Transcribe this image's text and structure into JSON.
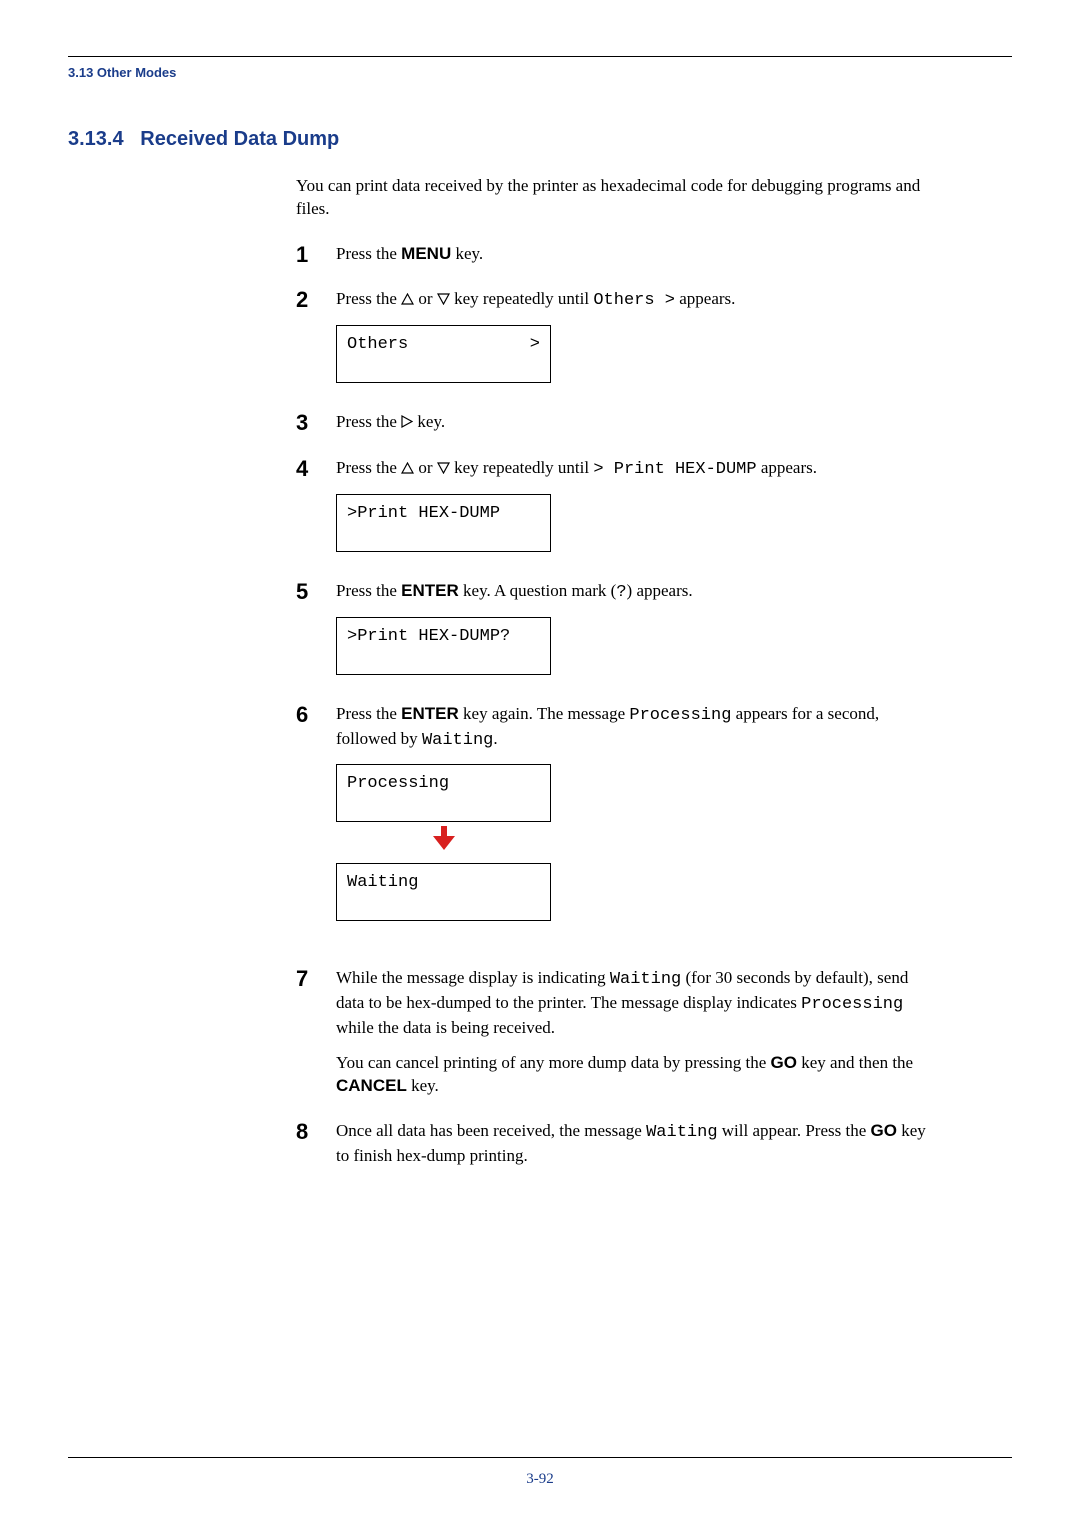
{
  "header": {
    "running": "3.13 Other Modes"
  },
  "section": {
    "number": "3.13.4",
    "title": "Received Data Dump",
    "intro": "You can print data received by the printer as hexadecimal code for debugging programs and files."
  },
  "keys": {
    "menu": "MENU",
    "enter": "ENTER",
    "go": "GO",
    "cancel": "CANCEL"
  },
  "steps": {
    "s1": {
      "num": "1",
      "text_a": "Press the ",
      "text_b": " key."
    },
    "s2": {
      "num": "2",
      "text_a": "Press the ",
      "text_b": " or ",
      "text_c": " key repeatedly until ",
      "mono": "Others >",
      "text_d": " appears.",
      "lcd_left": "Others",
      "lcd_right": ">"
    },
    "s3": {
      "num": "3",
      "text_a": "Press the ",
      "text_b": " key."
    },
    "s4": {
      "num": "4",
      "text_a": "Press the ",
      "text_b": " or ",
      "text_c": " key repeatedly until ",
      "mono1": "> Print HEX-DUMP",
      "text_d": " appears.",
      "lcd": ">Print HEX-DUMP"
    },
    "s5": {
      "num": "5",
      "text_a": "Press the ",
      "text_b": " key. A question mark (",
      "mono_q": "?",
      "text_c": ") appears.",
      "lcd": ">Print HEX-DUMP?"
    },
    "s6": {
      "num": "6",
      "text_a": "Press the ",
      "text_b": " key again. The message ",
      "mono1": "Processing",
      "text_c": " appears for a second, followed by ",
      "mono2": "Waiting",
      "text_d": ".",
      "lcd1": "Processing",
      "lcd2": "Waiting"
    },
    "s7": {
      "num": "7",
      "p1_a": "While the message display is indicating ",
      "p1_m1": "Waiting",
      "p1_b": " (for 30 seconds by default), send data to be hex-dumped to the printer. The message display indicates ",
      "p1_m2": "Processing",
      "p1_c": " while the data is being received.",
      "p2_a": "You can cancel printing of any more dump data by pressing the ",
      "p2_b": " key and then the ",
      "p2_c": " key."
    },
    "s8": {
      "num": "8",
      "text_a": "Once all data has been received, the message ",
      "mono1": "Waiting",
      "text_b": " will appear. Press the ",
      "text_c": " key to finish hex-dump printing."
    }
  },
  "page_number": "3-92"
}
